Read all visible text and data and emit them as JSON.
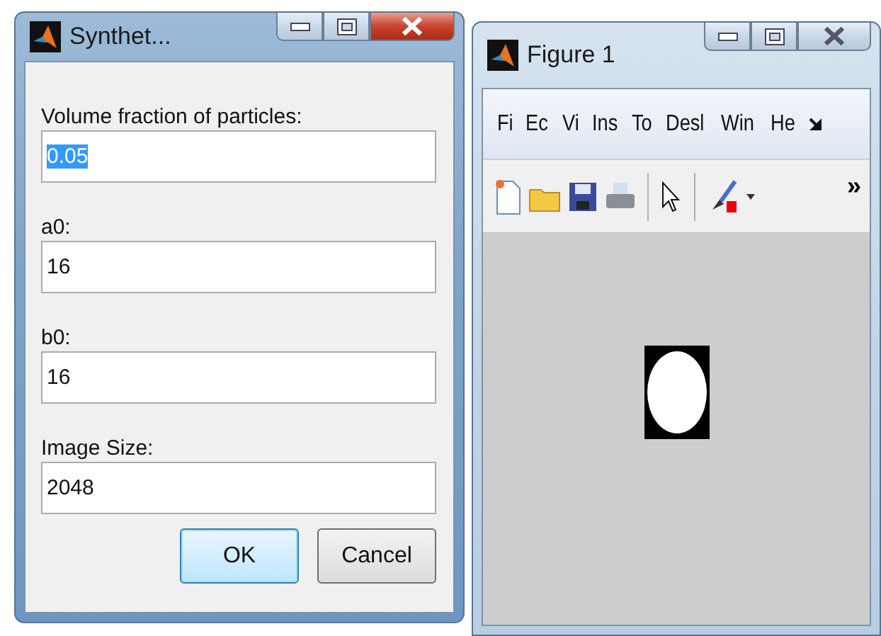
{
  "dialog": {
    "title": "Synthet...",
    "active": true,
    "fields": [
      {
        "label": "Volume fraction of particles:",
        "value": "0.05",
        "text_selected": true
      },
      {
        "label": "a0:",
        "value": "16",
        "text_selected": false
      },
      {
        "label": "b0:",
        "value": "16",
        "text_selected": false
      },
      {
        "label": "Image Size:",
        "value": "2048",
        "text_selected": false
      }
    ],
    "buttons": [
      {
        "label": "OK",
        "default": true
      },
      {
        "label": "Cancel",
        "default": false
      }
    ]
  },
  "figure": {
    "title": "Figure 1",
    "active": false,
    "menu": [
      "Fi",
      "Ec",
      "Vi",
      "Ins",
      "To",
      "Desl",
      "Win",
      "He"
    ],
    "toolbar_more": "»"
  }
}
